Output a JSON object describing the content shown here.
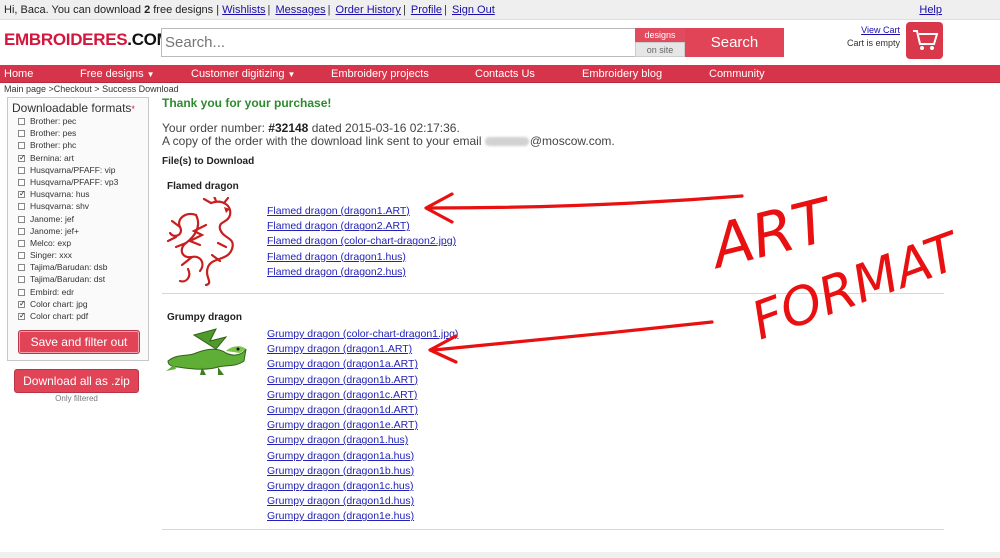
{
  "topbar": {
    "greeting_prefix": "Hi, Baca. You can download",
    "free_count": "2",
    "greeting_suffix": "free designs |",
    "links": [
      "Wishlists",
      "Messages",
      "Order History",
      "Profile",
      "Sign Out"
    ],
    "help": "Help"
  },
  "header": {
    "logo_part1": "EMBROIDERES",
    "logo_part2": ".COM",
    "search_placeholder": "Search...",
    "scope_top": "designs",
    "scope_bottom": "on site",
    "search_button": "Search",
    "view_cart": "View Cart",
    "cart_status": "Cart is empty",
    "cart_icon": "shopping-cart-icon"
  },
  "nav": {
    "items": [
      "Home",
      "Free designs",
      "Customer digitizing",
      "Embroidery projects",
      "Contacts Us",
      "Embroidery blog",
      "Community"
    ]
  },
  "breadcrumb": "Main page >Checkout > Success Download",
  "sidebar": {
    "title": "Downloadable formats",
    "required_mark": "*",
    "formats": [
      {
        "label": "Brother: pec",
        "checked": false
      },
      {
        "label": "Brother: pes",
        "checked": false
      },
      {
        "label": "Brother: phc",
        "checked": false
      },
      {
        "label": "Bernina: art",
        "checked": true
      },
      {
        "label": "Husqvarna/PFAFF: vip",
        "checked": false
      },
      {
        "label": "Husqvarna/PFAFF: vp3",
        "checked": false
      },
      {
        "label": "Husqvarna: hus",
        "checked": true
      },
      {
        "label": "Husqvarna: shv",
        "checked": false
      },
      {
        "label": "Janome: jef",
        "checked": false
      },
      {
        "label": "Janome: jef+",
        "checked": false
      },
      {
        "label": "Melco: exp",
        "checked": false
      },
      {
        "label": "Singer: xxx",
        "checked": false
      },
      {
        "label": "Tajima/Barudan: dsb",
        "checked": false
      },
      {
        "label": "Tajima/Barudan: dst",
        "checked": false
      },
      {
        "label": "Embird: edr",
        "checked": false
      },
      {
        "label": "Color chart: jpg",
        "checked": true
      },
      {
        "label": "Color chart: pdf",
        "checked": true
      }
    ],
    "filter_button": "Save and filter out",
    "zip_button": "Download all as .zip",
    "zip_note": "Only filtered"
  },
  "main": {
    "thanks": "Thank you for your purchase!",
    "order_prefix": "Your order number:",
    "order_number": "#32148",
    "order_suffix": "dated 2015-03-16 02:17:36.",
    "email_prefix": "A copy of the order with the download link sent to your email",
    "email_domain": "@moscow.com.",
    "files_heading": "File(s) to Download",
    "groups": [
      {
        "title": "Flamed dragon",
        "thumb_icon": "red-dragon-thumbnail",
        "files": [
          "Flamed dragon (dragon1.ART)",
          "Flamed dragon (dragon2.ART)",
          "Flamed dragon (color-chart-dragon2.jpg)",
          "Flamed dragon (dragon1.hus)",
          "Flamed dragon (dragon2.hus)"
        ]
      },
      {
        "title": "Grumpy dragon",
        "thumb_icon": "green-dragon-thumbnail",
        "files": [
          "Grumpy dragon (color-chart-dragon1.jpg)",
          "Grumpy dragon (dragon1.ART)",
          "Grumpy dragon (dragon1a.ART)",
          "Grumpy dragon (dragon1b.ART)",
          "Grumpy dragon (dragon1c.ART)",
          "Grumpy dragon (dragon1d.ART)",
          "Grumpy dragon (dragon1e.ART)",
          "Grumpy dragon (dragon1.hus)",
          "Grumpy dragon (dragon1a.hus)",
          "Grumpy dragon (dragon1b.hus)",
          "Grumpy dragon (dragon1c.hus)",
          "Grumpy dragon (dragon1d.hus)",
          "Grumpy dragon (dragon1e.hus)"
        ]
      }
    ]
  },
  "annotation": {
    "color": "#e81010",
    "word1": "ART",
    "word2": "FORMAT"
  },
  "colors": {
    "brand_red": "#d6344a",
    "button_red": "#e04456",
    "thanks_green": "#2f8a2f",
    "link_blue": "#2323b8"
  }
}
